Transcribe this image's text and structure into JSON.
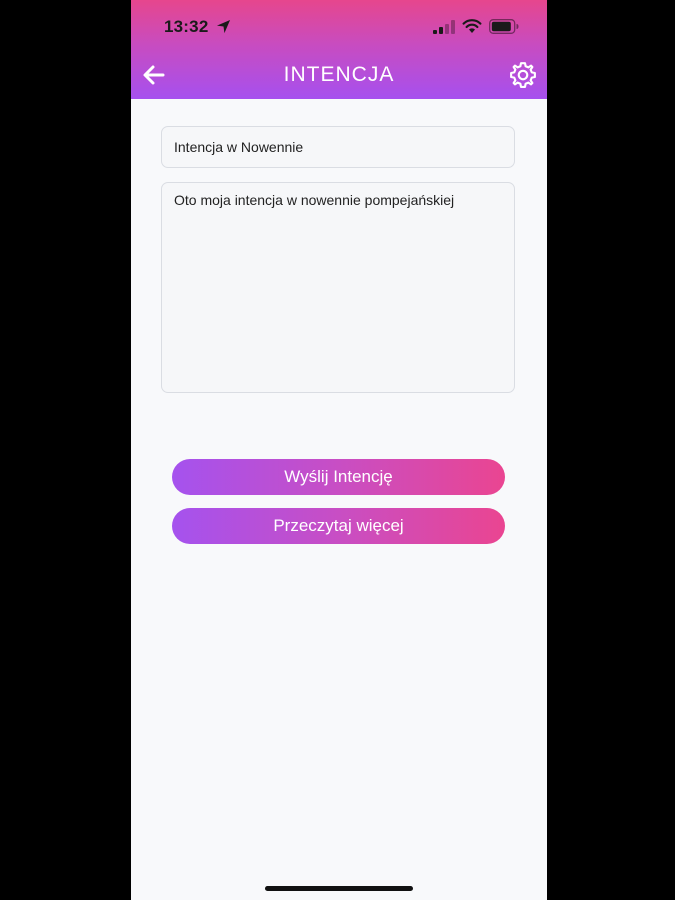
{
  "status_bar": {
    "time": "13:32",
    "icons": [
      "location-arrow-icon",
      "cellular-signal-icon",
      "wifi-icon",
      "battery-icon"
    ]
  },
  "header": {
    "title": "INTENCJA",
    "back_icon": "arrow-left-icon",
    "settings_icon": "gear-icon"
  },
  "form": {
    "title_value": "Intencja w Nowennie",
    "intent_value": "Oto moja intencja w nowennie pompejańskiej"
  },
  "buttons": {
    "send_label": "Wyślij Intencję",
    "more_label": "Przeczytaj więcej"
  },
  "colors": {
    "gradient_pink": "#ea4591",
    "gradient_purple": "#a552ee",
    "background": "#f8f9fb"
  }
}
